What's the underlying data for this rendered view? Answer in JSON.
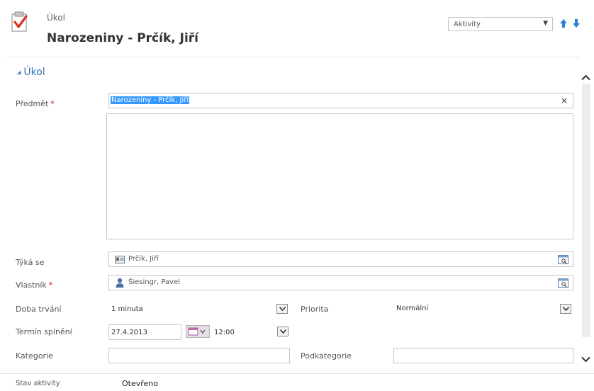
{
  "header": {
    "entity_type": "Úkol",
    "title": "Narozeniny - Prčík, Jiří",
    "nav_select": "Aktivity"
  },
  "section": {
    "title": "Úkol"
  },
  "fields": {
    "subject": {
      "label": "Předmět",
      "required": "*",
      "value": "Narozeniny - Prčík, Jiří",
      "clear": "×"
    },
    "regarding": {
      "label": "Týká se",
      "value": "Prčík, Jiří"
    },
    "owner": {
      "label": "Vlastník",
      "required": "*",
      "value": "Šiesingr, Pavel"
    },
    "duration": {
      "label": "Doba trvání",
      "value": "1 minuta"
    },
    "priority": {
      "label": "Priorita",
      "value": "Normální"
    },
    "due": {
      "label": "Termín splnění",
      "date": "27.4.2013",
      "time": "12:00"
    },
    "category": {
      "label": "Kategorie",
      "value": ""
    },
    "subcategory": {
      "label": "Podkategorie",
      "value": ""
    }
  },
  "footer": {
    "status_label": "Stav aktivity",
    "status_value": "Otevřeno"
  },
  "colors": {
    "selection": "#3399ff",
    "nav_arrow": "#2a7fd4",
    "required": "#dd0000"
  }
}
